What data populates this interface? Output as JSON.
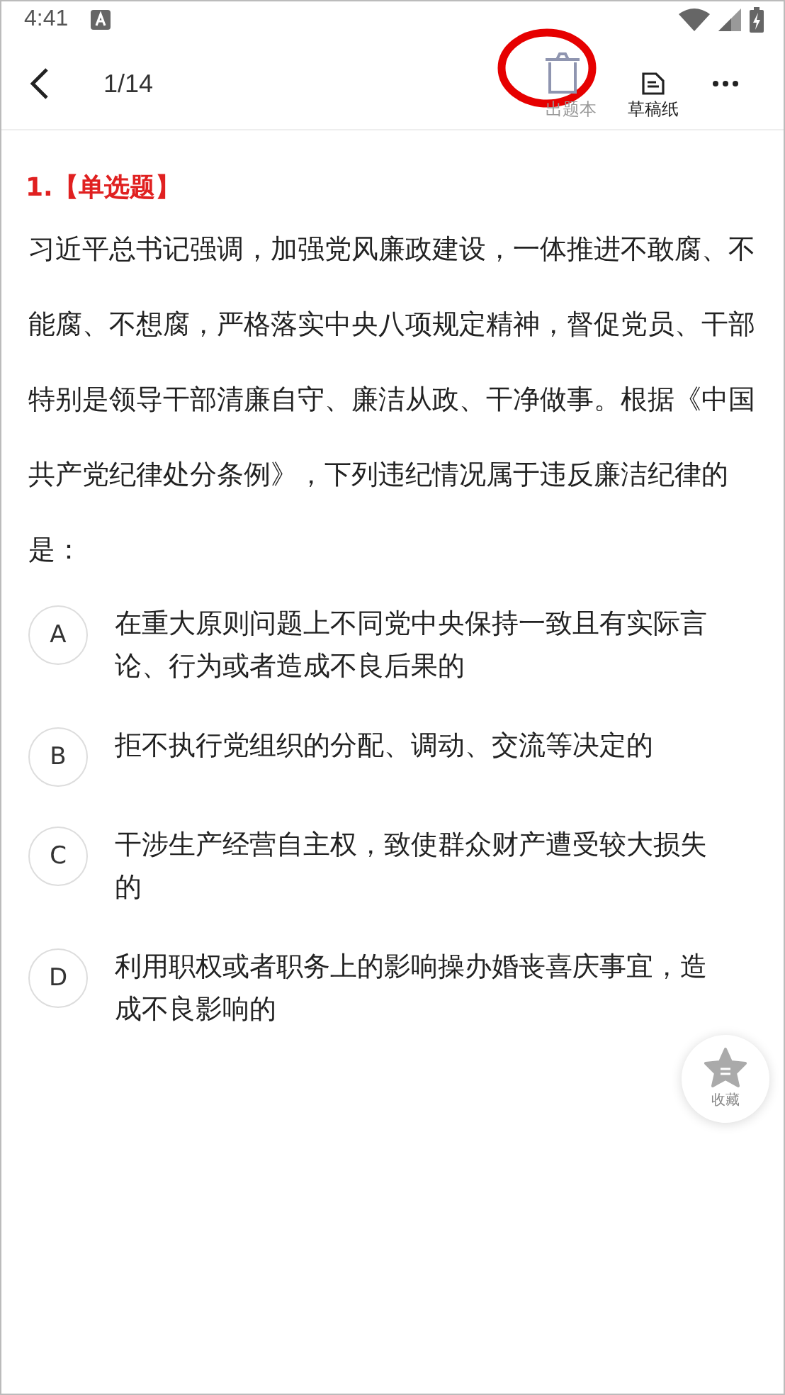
{
  "status_bar": {
    "time": "4:41"
  },
  "toolbar": {
    "progress": "1/14",
    "actions": [
      {
        "kind": "remove",
        "label": "出题本",
        "circled": true
      },
      {
        "kind": "draft",
        "label": "草稿纸",
        "circled": false
      }
    ]
  },
  "question": {
    "number": "1.",
    "type": "【单选题】",
    "text": "习近平总书记强调，加强党风廉政建设，一体推进不敢腐、不能腐、不想腐，严格落实中央八项规定精神，督促党员、干部特别是领导干部清廉自守、廉洁从政、干净做事。根据《中国共产党纪律处分条例》，下列违纪情况属于违反廉洁纪律的是：",
    "options": [
      {
        "letter": "A",
        "text": "在重大原则问题上不同党中央保持一致且有实际言论、行为或者造成不良后果的",
        "selected": false
      },
      {
        "letter": "B",
        "text": "拒不执行党组织的分配、调动、交流等决定的",
        "selected": false
      },
      {
        "letter": "C",
        "text": "干涉生产经营自主权，致使群众财产遭受较大损失的",
        "selected": false
      },
      {
        "letter": "D",
        "text": "利用职权或者职务上的影响操办婚丧喜庆事宜，造成不良影响的",
        "selected": false
      }
    ]
  },
  "favorite": {
    "label": "收藏",
    "on": false
  }
}
